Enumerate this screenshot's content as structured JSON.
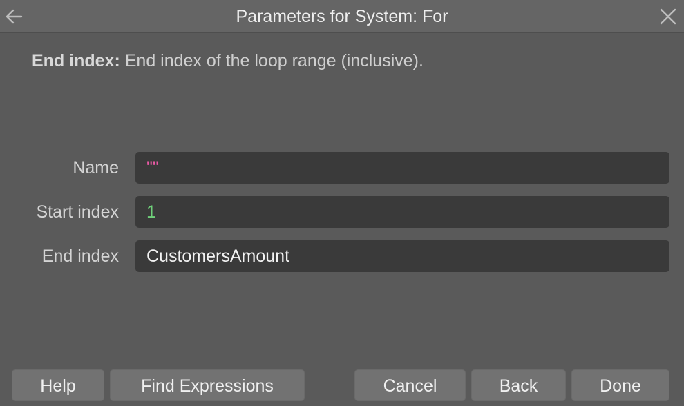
{
  "window": {
    "title": "Parameters for System: For"
  },
  "description": {
    "term": "End index:",
    "text": " End index of the loop range (inclusive)."
  },
  "fields": [
    {
      "label": "Name",
      "value": "\"\""
    },
    {
      "label": "Start index",
      "value": "1"
    },
    {
      "label": "End index",
      "value": "CustomersAmount"
    }
  ],
  "buttons": {
    "help": "Help",
    "find_expressions": "Find Expressions",
    "cancel": "Cancel",
    "back": "Back",
    "done": "Done"
  },
  "colors": {
    "background": "#5a5a5a",
    "titlebar": "#656565",
    "field_bg": "#3a3a3a",
    "button_bg": "#727272",
    "string_value": "#e85aa4",
    "number_value": "#6fd07a"
  },
  "icons": {
    "back": "arrow-left-icon",
    "close": "close-icon"
  }
}
